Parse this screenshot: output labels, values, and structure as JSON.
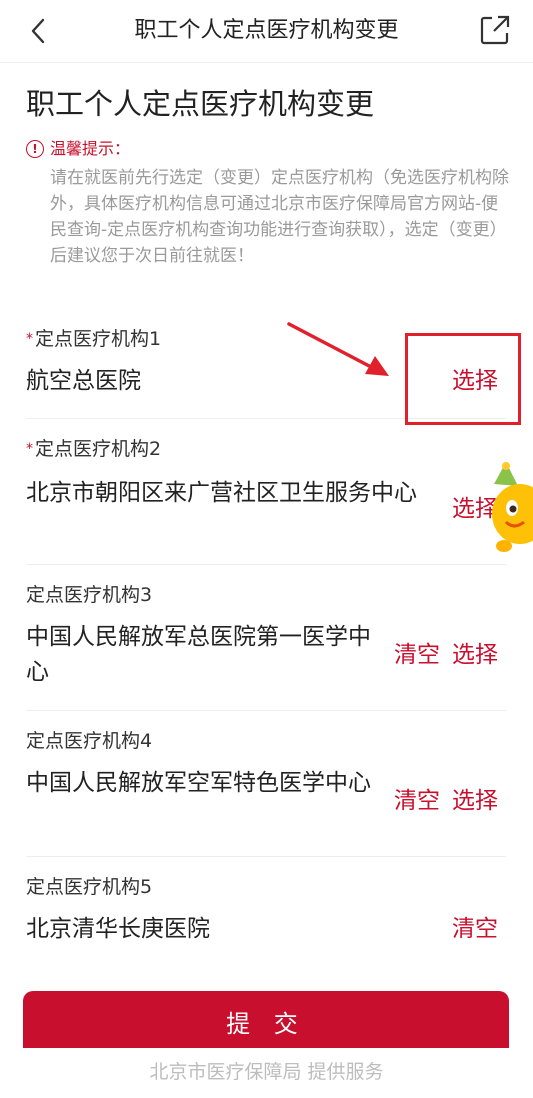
{
  "header": {
    "title": "职工个人定点医疗机构变更"
  },
  "page_title": "职工个人定点医疗机构变更",
  "tip": {
    "heading": "温馨提示：",
    "body": "请在就医前先行选定（变更）定点医疗机构（免选医疗机构除外，具体医疗机构信息可通过北京市医疗保障局官方网站-便民查询-定点医疗机构查询功能进行查询获取），选定（变更）后建议您于次日前往就医！"
  },
  "institutions": [
    {
      "label": "定点医疗机构1",
      "required": "*",
      "value": "航空总医院",
      "select": "选择"
    },
    {
      "label": "定点医疗机构2",
      "required": "*",
      "value": "北京市朝阳区来广营社区卫生服务中心",
      "select": "选择"
    },
    {
      "label": "定点医疗机构3",
      "value": "中国人民解放军总医院第一医学中心",
      "clear": "清空",
      "select": "选择"
    },
    {
      "label": "定点医疗机构4",
      "value": "中国人民解放军空军特色医学中心",
      "clear": "清空",
      "select": "选择"
    },
    {
      "label": "定点医疗机构5",
      "value": "北京清华长庚医院",
      "clear": "清空"
    }
  ],
  "submit_label": "提 交",
  "footer": "北京市医疗保障局 提供服务",
  "colors": {
    "accent": "#c8102e",
    "annotation": "#e0202a"
  },
  "icons": {
    "back": "chevron-left-icon",
    "share": "share-icon",
    "tip": "exclamation-circle-icon"
  }
}
